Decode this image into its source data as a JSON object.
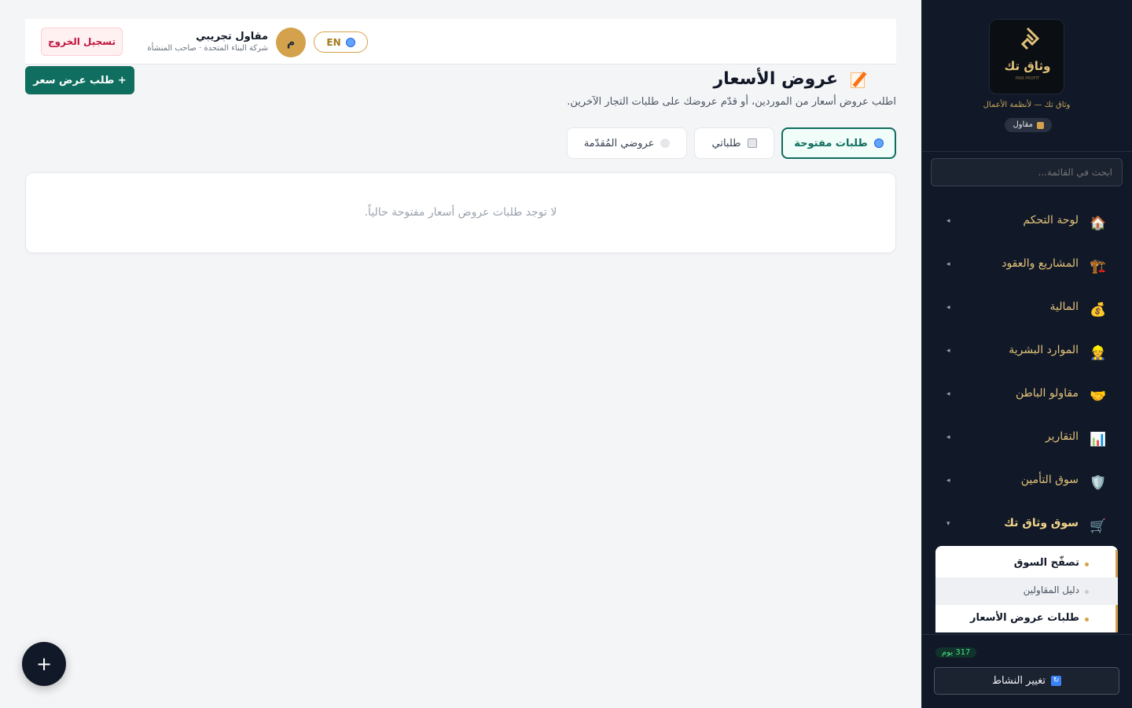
{
  "header": {
    "logout_label": "تسجيل الخروج",
    "user_name": "مقاول تجريبي",
    "user_subtitle": "شركة البناء المتحدة · صاحب المنشأة",
    "avatar_initial": "م",
    "language_label": "EN"
  },
  "page": {
    "title": "عروض الأسعار",
    "description": "اطلب عروض أسعار من الموردين، أو قدّم عروضك على طلبات التجار الآخرين.",
    "new_request_label": "+ طلب عرض سعر",
    "tabs": [
      {
        "label": "طلبات مفتوحة",
        "icon": "globe-icon",
        "active": true
      },
      {
        "label": "طلباتي",
        "icon": "clipboard-icon",
        "active": false
      },
      {
        "label": "عروضي المُقدّمة",
        "icon": "speech-bubble-icon",
        "active": false
      }
    ],
    "empty_message": "لا توجد طلبات عروض أسعار مفتوحة حالياً."
  },
  "sidebar": {
    "brand_name": "وثاق تك",
    "brand_logo_tagline": "FAIR PROFIT",
    "brand_subtitle": "وثاق تك — لأنظمة الأعمال",
    "role_label": "مقاول",
    "search_placeholder": "ابحث في القائمة...",
    "items": [
      {
        "label": "لوحة التحكم",
        "icon": "house-icon",
        "emoji": "🏠"
      },
      {
        "label": "المشاريع والعقود",
        "icon": "construction-icon",
        "emoji": "🏗️"
      },
      {
        "label": "المالية",
        "icon": "money-bag-icon",
        "emoji": "💰"
      },
      {
        "label": "الموارد البشرية",
        "icon": "worker-icon",
        "emoji": "👷"
      },
      {
        "label": "مقاولو الباطن",
        "icon": "handshake-icon",
        "emoji": "🤝"
      },
      {
        "label": "التقارير",
        "icon": "bar-chart-icon",
        "emoji": "📊"
      },
      {
        "label": "سوق التأمين",
        "icon": "shield-icon",
        "emoji": "🛡️"
      },
      {
        "label": "سوق وثاق تك",
        "icon": "cart-icon",
        "emoji": "🛒"
      }
    ],
    "sub_items": [
      {
        "label": "تصفّح السوق"
      },
      {
        "label": "دليل المقاولين"
      },
      {
        "label": "طلبات عروض الأسعار"
      }
    ],
    "days_badge": "317 يوم",
    "switch_activity_label": "تغيير النشاط"
  },
  "fab_label": "+",
  "colors": {
    "accent": "#0f6e5f",
    "gold": "#d4a24c",
    "sidebar_bg": "#111827",
    "danger": "#be123c"
  }
}
